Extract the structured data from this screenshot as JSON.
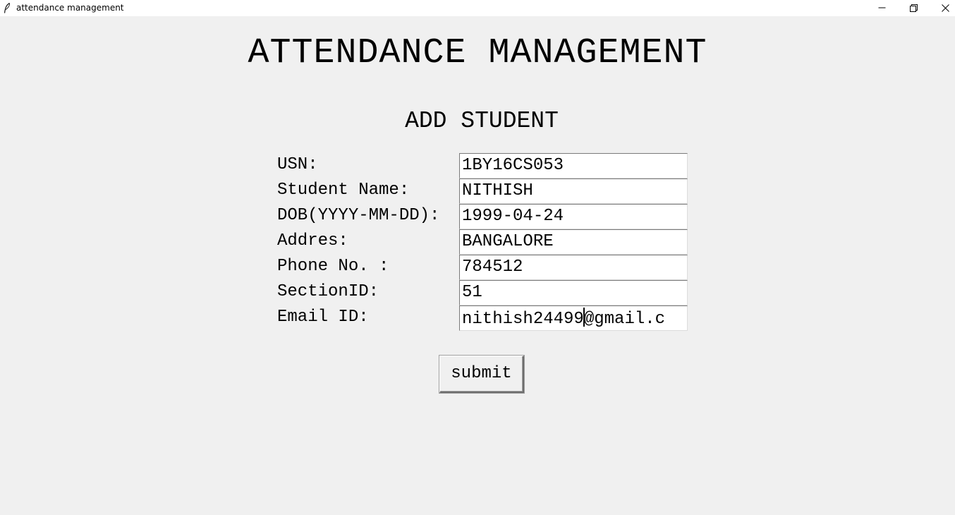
{
  "window": {
    "title": "attendance management",
    "icons": {
      "app": "feather-icon",
      "minimize": "minimize-icon",
      "restore": "restore-icon",
      "close": "close-icon"
    }
  },
  "header": {
    "title": "ATTENDANCE MANAGEMENT"
  },
  "form": {
    "title": "ADD STUDENT",
    "fields": [
      {
        "label": "USN:",
        "value": "1BY16CS053"
      },
      {
        "label": "Student Name:",
        "value": "NITHISH"
      },
      {
        "label": "DOB(YYYY-MM-DD):",
        "value": "1999-04-24"
      },
      {
        "label": "Addres:",
        "value": "BANGALORE"
      },
      {
        "label": "Phone No. :",
        "value": "784512"
      },
      {
        "label": "SectionID:",
        "value": "51"
      },
      {
        "label": "Email ID:",
        "value_before_cursor": "nithish24499",
        "value_after_cursor": "@gmail.c"
      }
    ],
    "submit_label": "submit"
  }
}
